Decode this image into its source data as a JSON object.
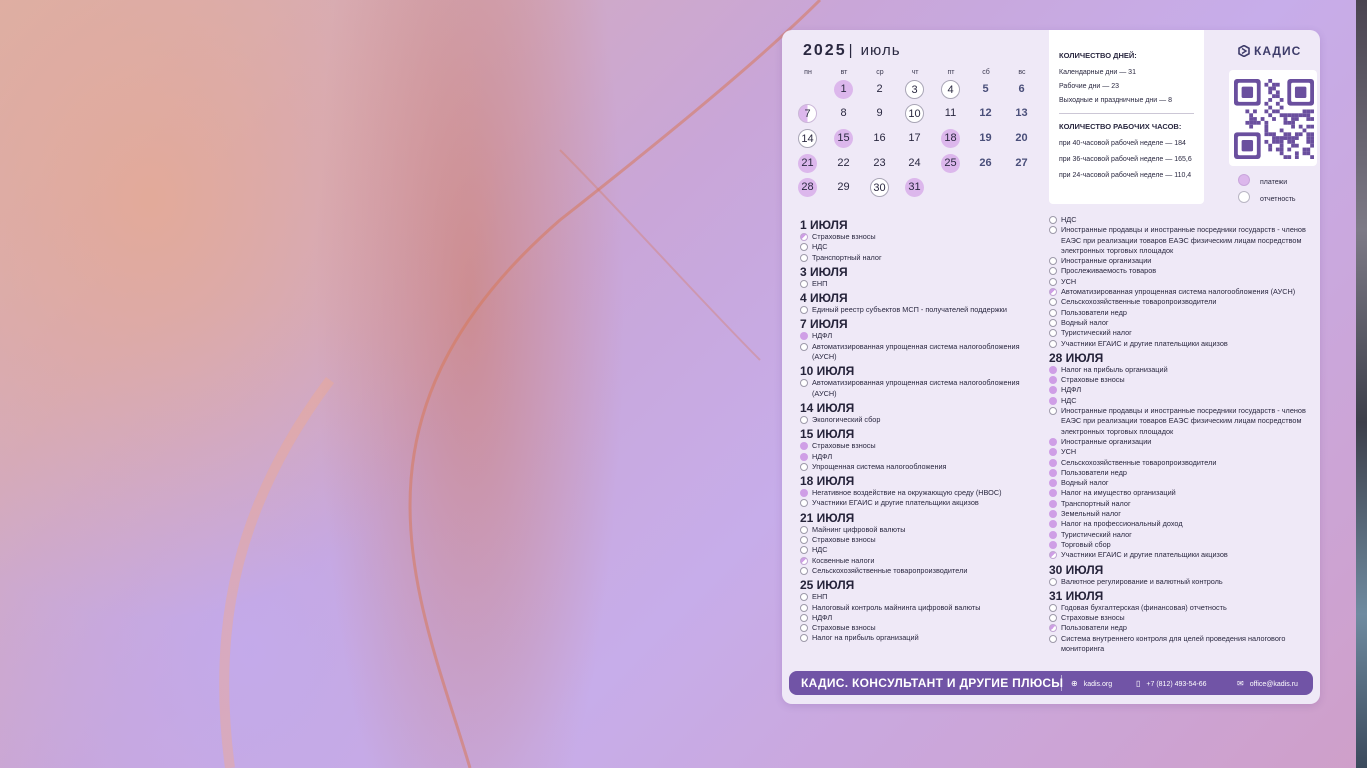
{
  "calendar": {
    "year": "2025",
    "month": "июль",
    "weekdays": [
      "пн",
      "вт",
      "ср",
      "чт",
      "пт",
      "сб",
      "вс"
    ],
    "days": [
      {
        "n": "1",
        "s": "p"
      },
      {
        "n": "2",
        "s": ""
      },
      {
        "n": "3",
        "s": "o"
      },
      {
        "n": "4",
        "s": "o"
      },
      {
        "n": "5",
        "s": "we"
      },
      {
        "n": "6",
        "s": "we"
      },
      {
        "n": "7",
        "s": "h"
      },
      {
        "n": "8",
        "s": ""
      },
      {
        "n": "9",
        "s": ""
      },
      {
        "n": "10",
        "s": "o"
      },
      {
        "n": "11",
        "s": ""
      },
      {
        "n": "12",
        "s": "we"
      },
      {
        "n": "13",
        "s": "we"
      },
      {
        "n": "14",
        "s": "o"
      },
      {
        "n": "15",
        "s": "p"
      },
      {
        "n": "16",
        "s": ""
      },
      {
        "n": "17",
        "s": ""
      },
      {
        "n": "18",
        "s": "p"
      },
      {
        "n": "19",
        "s": "we"
      },
      {
        "n": "20",
        "s": "we"
      },
      {
        "n": "21",
        "s": "p"
      },
      {
        "n": "22",
        "s": ""
      },
      {
        "n": "23",
        "s": ""
      },
      {
        "n": "24",
        "s": ""
      },
      {
        "n": "25",
        "s": "p"
      },
      {
        "n": "26",
        "s": "we"
      },
      {
        "n": "27",
        "s": "we"
      },
      {
        "n": "28",
        "s": "p"
      },
      {
        "n": "29",
        "s": ""
      },
      {
        "n": "30",
        "s": "o"
      },
      {
        "n": "31",
        "s": "p"
      }
    ]
  },
  "info": {
    "days_title": "КОЛИЧЕСТВО ДНЕЙ:",
    "calendar_days": "Календарные дни — 31",
    "work_days": "Рабочие дни — 23",
    "holidays": "Выходные и праздничные дни — 8",
    "hours_title": "КОЛИЧЕСТВО РАБОЧИХ ЧАСОВ:",
    "h40": "при 40-часовой рабочей неделе — 184",
    "h36": "при 36-часовой рабочей неделе — 165,6",
    "h24": "при 24-часовой рабочей неделе — 110,4"
  },
  "brand": {
    "logo": "КАДИС",
    "accent": "#7154a6"
  },
  "legend": {
    "payments": "платежи",
    "reports": "отчетность"
  },
  "left_col": [
    {
      "date": "1 ИЮЛЯ",
      "items": [
        [
          "h",
          "Страховые взносы"
        ],
        [
          "o",
          "НДС"
        ],
        [
          "o",
          "Транспортный налог"
        ]
      ]
    },
    {
      "date": "3 ИЮЛЯ",
      "items": [
        [
          "o",
          "ЕНП"
        ]
      ]
    },
    {
      "date": "4 ИЮЛЯ",
      "items": [
        [
          "o",
          "Единый реестр субъектов МСП - получателей поддержки"
        ]
      ]
    },
    {
      "date": "7 ИЮЛЯ",
      "items": [
        [
          "p",
          "НДФЛ"
        ],
        [
          "o",
          "Автоматизированная упрощенная система налогообложения (АУСН)"
        ]
      ]
    },
    {
      "date": "10 ИЮЛЯ",
      "items": [
        [
          "o",
          "Автоматизированная упрощенная система налогообложения (АУСН)"
        ]
      ]
    },
    {
      "date": "14 ИЮЛЯ",
      "items": [
        [
          "o",
          "Экологический сбор"
        ]
      ]
    },
    {
      "date": "15 ИЮЛЯ",
      "items": [
        [
          "p",
          "Страховые взносы"
        ],
        [
          "p",
          "НДФЛ"
        ],
        [
          "o",
          "Упрощенная система налогообложения"
        ]
      ]
    },
    {
      "date": "18 ИЮЛЯ",
      "items": [
        [
          "p",
          "Негативное воздействие на окружающую среду (НВОС)"
        ],
        [
          "o",
          "Участники ЕГАИС и другие плательщики акцизов"
        ]
      ]
    },
    {
      "date": "21 ИЮЛЯ",
      "items": [
        [
          "o",
          "Майнинг цифровой валюты"
        ],
        [
          "o",
          "Страховые взносы"
        ],
        [
          "o",
          "НДС"
        ],
        [
          "h",
          "Косвенные налоги"
        ],
        [
          "o",
          "Сельскохозяйственные товаропроизводители"
        ]
      ]
    },
    {
      "date": "25 ИЮЛЯ",
      "items": [
        [
          "o",
          "ЕНП"
        ],
        [
          "o",
          "Налоговый контроль майнинга цифровой валюты"
        ],
        [
          "o",
          "НДФЛ"
        ],
        [
          "o",
          "Страховые взносы"
        ],
        [
          "o",
          "Налог на прибыль организаций"
        ]
      ]
    }
  ],
  "right_col": [
    {
      "date": "",
      "items": [
        [
          "o",
          "НДС"
        ],
        [
          "o",
          "Иностранные продавцы и иностранные посредники государств - членов ЕАЭС при реализации товаров ЕАЭС физическим лицам посредством электронных торговых площадок"
        ],
        [
          "o",
          "Иностранные организации"
        ],
        [
          "o",
          "Прослеживаемость товаров"
        ],
        [
          "o",
          "УСН"
        ],
        [
          "h",
          "Автоматизированная упрощенная система налогообложения (АУСН)"
        ],
        [
          "o",
          "Сельскохозяйственные товаропроизводители"
        ],
        [
          "o",
          "Пользователи недр"
        ],
        [
          "o",
          "Водный налог"
        ],
        [
          "o",
          "Туристический налог"
        ],
        [
          "o",
          "Участники ЕГАИС и другие плательщики акцизов"
        ]
      ]
    },
    {
      "date": "28 ИЮЛЯ",
      "items": [
        [
          "p",
          "Налог на прибыль организаций"
        ],
        [
          "p",
          "Страховые взносы"
        ],
        [
          "p",
          "НДФЛ"
        ],
        [
          "p",
          "НДС"
        ],
        [
          "o",
          "Иностранные продавцы и иностранные посредники государств - членов ЕАЭС при реализации товаров ЕАЭС физическим лицам посредством электронных торговых площадок"
        ],
        [
          "p",
          "Иностранные организации"
        ],
        [
          "p",
          "УСН"
        ],
        [
          "p",
          "Сельскохозяйственные товаропроизводители"
        ],
        [
          "p",
          "Пользователи недр"
        ],
        [
          "p",
          "Водный налог"
        ],
        [
          "p",
          "Налог на имущество организаций"
        ],
        [
          "p",
          "Транспортный налог"
        ],
        [
          "p",
          "Земельный налог"
        ],
        [
          "p",
          "Налог на профессиональный доход"
        ],
        [
          "p",
          "Туристический налог"
        ],
        [
          "p",
          "Торговый сбор"
        ],
        [
          "h",
          "Участники ЕГАИС и другие плательщики акцизов"
        ]
      ]
    },
    {
      "date": "30 ИЮЛЯ",
      "items": [
        [
          "o",
          "Валютное регулирование и валютный контроль"
        ]
      ]
    },
    {
      "date": "31 ИЮЛЯ",
      "items": [
        [
          "o",
          "Годовая бухгалтерская (финансовая) отчетность"
        ],
        [
          "o",
          "Страховые взносы"
        ],
        [
          "h",
          "Пользователи недр"
        ],
        [
          "o",
          "Система внутреннего контроля для целей проведения налогового мониторинга"
        ]
      ]
    }
  ],
  "footer": {
    "title": "КАДИС. КОНСУЛЬТАНТ И ДРУГИЕ ПЛЮСЫ",
    "site": "kadis.org",
    "phone": "+7 (812) 493-54-66",
    "email": "office@kadis.ru"
  }
}
